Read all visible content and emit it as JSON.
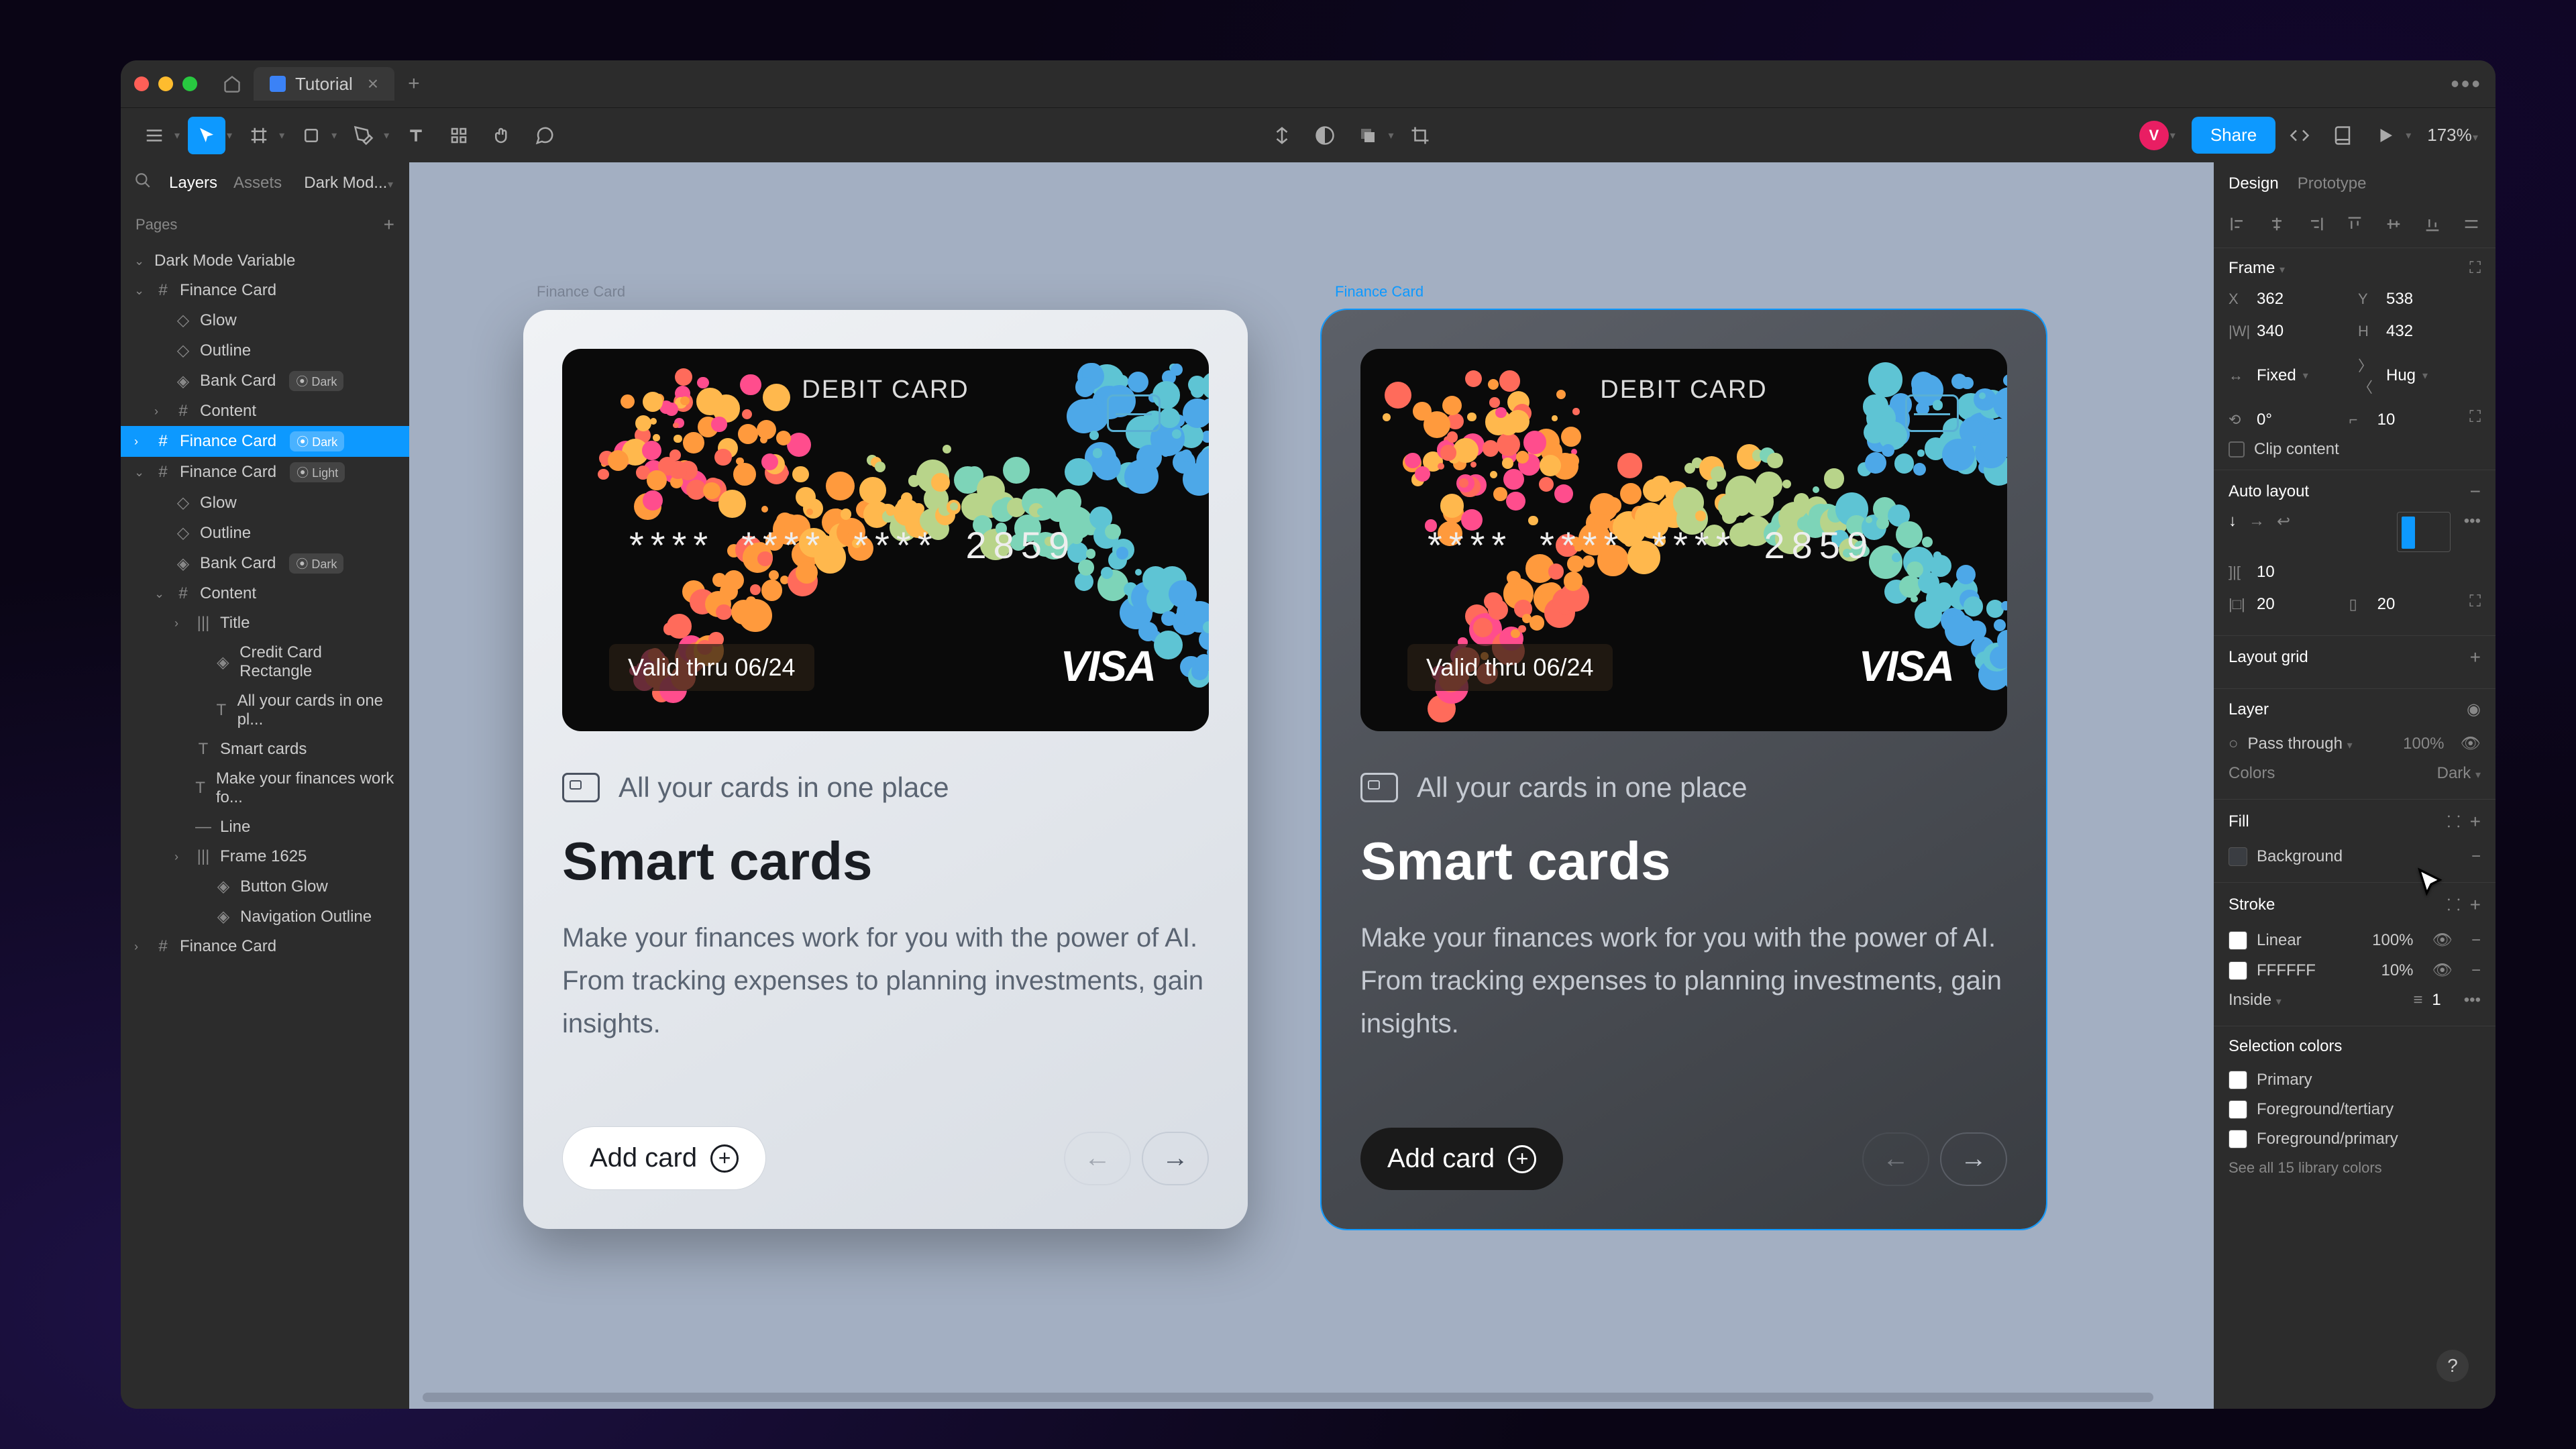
{
  "tab": {
    "title": "Tutorial"
  },
  "toolbar": {
    "zoom": "173%",
    "share": "Share",
    "avatar": "V"
  },
  "leftPanel": {
    "tabs": {
      "layers": "Layers",
      "assets": "Assets",
      "page": "Dark Mod..."
    },
    "pagesHeader": "Pages",
    "currentPage": "Dark Mode Variable",
    "layers": [
      {
        "name": "Finance Card",
        "indent": 0,
        "icon": "frame",
        "open": true
      },
      {
        "name": "Glow",
        "indent": 1,
        "icon": "shape"
      },
      {
        "name": "Outline",
        "indent": 1,
        "icon": "shape"
      },
      {
        "name": "Bank Card",
        "indent": 1,
        "icon": "comp",
        "badge": "Dark"
      },
      {
        "name": "Content",
        "indent": 1,
        "icon": "frame"
      },
      {
        "name": "Finance Card",
        "indent": 0,
        "icon": "frame",
        "badge": "Dark",
        "sel": true
      },
      {
        "name": "Finance Card",
        "indent": 0,
        "icon": "frame",
        "badge": "Light",
        "open": true
      },
      {
        "name": "Glow",
        "indent": 1,
        "icon": "shape"
      },
      {
        "name": "Outline",
        "indent": 1,
        "icon": "shape"
      },
      {
        "name": "Bank Card",
        "indent": 1,
        "icon": "comp",
        "badge": "Dark"
      },
      {
        "name": "Content",
        "indent": 1,
        "icon": "frame",
        "open": true
      },
      {
        "name": "Title",
        "indent": 2,
        "icon": "al"
      },
      {
        "name": "Credit Card Rectangle",
        "indent": 3,
        "icon": "comp"
      },
      {
        "name": "All your cards in one pl...",
        "indent": 3,
        "icon": "text"
      },
      {
        "name": "Smart cards",
        "indent": 2,
        "icon": "text"
      },
      {
        "name": "Make your finances work fo...",
        "indent": 2,
        "icon": "text"
      },
      {
        "name": "Line",
        "indent": 2,
        "icon": "line"
      },
      {
        "name": "Frame 1625",
        "indent": 2,
        "icon": "al"
      },
      {
        "name": "Button Glow",
        "indent": 3,
        "icon": "comp"
      },
      {
        "name": "Navigation Outline",
        "indent": 3,
        "icon": "comp"
      },
      {
        "name": "Finance Card",
        "indent": 0,
        "icon": "frame"
      }
    ]
  },
  "canvas": {
    "frameLabel1": "Finance Card",
    "frameLabel2": "Finance Card",
    "card": {
      "type": "DEBIT CARD",
      "n1": "****",
      "n2": "****",
      "n3": "****",
      "n4": "2859",
      "valid": "Valid thru 06/24",
      "brand": "VISA"
    },
    "content": {
      "subtitle": "All your cards in one place",
      "title": "Smart cards",
      "body": "Make your finances work for you with the power of AI. From tracking expenses to planning investments, gain insights.",
      "addBtn": "Add card"
    }
  },
  "rightPanel": {
    "tabs": {
      "design": "Design",
      "prototype": "Prototype"
    },
    "frame": {
      "title": "Frame",
      "x": "362",
      "y": "538",
      "w": "340",
      "h": "432",
      "wMode": "Fixed",
      "hMode": "Hug",
      "rotation": "0°",
      "radius": "10",
      "clip": "Clip content"
    },
    "autoLayout": {
      "title": "Auto layout",
      "gap": "10",
      "padH": "20",
      "padV": "20"
    },
    "layoutGrid": "Layout grid",
    "layer": {
      "title": "Layer",
      "blend": "Pass through",
      "opacity": "100%",
      "colorsLabel": "Colors",
      "colorsMode": "Dark"
    },
    "fill": {
      "title": "Fill",
      "name": "Background"
    },
    "stroke": {
      "title": "Stroke",
      "items": [
        {
          "name": "Linear",
          "opacity": "100%"
        },
        {
          "name": "FFFFFF",
          "opacity": "10%"
        }
      ],
      "position": "Inside",
      "weight": "1"
    },
    "selectionColors": {
      "title": "Selection colors",
      "items": [
        "Primary",
        "Foreground/tertiary",
        "Foreground/primary"
      ],
      "seeAll": "See all 15 library colors"
    }
  }
}
